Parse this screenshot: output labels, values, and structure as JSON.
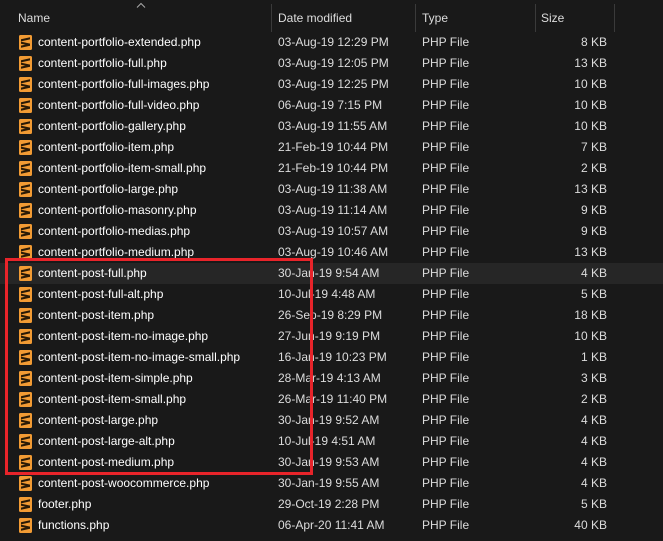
{
  "header": {
    "name": "Name",
    "date_modified": "Date modified",
    "type": "Type",
    "size": "Size"
  },
  "files": [
    {
      "name": "content-portfolio-extended.php",
      "date": "03-Aug-19 12:29 PM",
      "type": "PHP File",
      "size": "8 KB"
    },
    {
      "name": "content-portfolio-full.php",
      "date": "03-Aug-19 12:05 PM",
      "type": "PHP File",
      "size": "13 KB"
    },
    {
      "name": "content-portfolio-full-images.php",
      "date": "03-Aug-19 12:25 PM",
      "type": "PHP File",
      "size": "10 KB"
    },
    {
      "name": "content-portfolio-full-video.php",
      "date": "06-Aug-19 7:15 PM",
      "type": "PHP File",
      "size": "10 KB"
    },
    {
      "name": "content-portfolio-gallery.php",
      "date": "03-Aug-19 11:55 AM",
      "type": "PHP File",
      "size": "10 KB"
    },
    {
      "name": "content-portfolio-item.php",
      "date": "21-Feb-19 10:44 PM",
      "type": "PHP File",
      "size": "7 KB"
    },
    {
      "name": "content-portfolio-item-small.php",
      "date": "21-Feb-19 10:44 PM",
      "type": "PHP File",
      "size": "2 KB"
    },
    {
      "name": "content-portfolio-large.php",
      "date": "03-Aug-19 11:38 AM",
      "type": "PHP File",
      "size": "13 KB"
    },
    {
      "name": "content-portfolio-masonry.php",
      "date": "03-Aug-19 11:14 AM",
      "type": "PHP File",
      "size": "9 KB"
    },
    {
      "name": "content-portfolio-medias.php",
      "date": "03-Aug-19 10:57 AM",
      "type": "PHP File",
      "size": "9 KB"
    },
    {
      "name": "content-portfolio-medium.php",
      "date": "03-Aug-19 10:46 AM",
      "type": "PHP File",
      "size": "13 KB"
    },
    {
      "name": "content-post-full.php",
      "date": "30-Jan-19 9:54 AM",
      "type": "PHP File",
      "size": "4 KB",
      "selected": true
    },
    {
      "name": "content-post-full-alt.php",
      "date": "10-Jul-19 4:48 AM",
      "type": "PHP File",
      "size": "5 KB"
    },
    {
      "name": "content-post-item.php",
      "date": "26-Sep-19 8:29 PM",
      "type": "PHP File",
      "size": "18 KB"
    },
    {
      "name": "content-post-item-no-image.php",
      "date": "27-Jun-19 9:19 PM",
      "type": "PHP File",
      "size": "10 KB"
    },
    {
      "name": "content-post-item-no-image-small.php",
      "date": "16-Jan-19 10:23 PM",
      "type": "PHP File",
      "size": "1 KB"
    },
    {
      "name": "content-post-item-simple.php",
      "date": "28-Mar-19 4:13 AM",
      "type": "PHP File",
      "size": "3 KB"
    },
    {
      "name": "content-post-item-small.php",
      "date": "26-Mar-19 11:40 PM",
      "type": "PHP File",
      "size": "2 KB"
    },
    {
      "name": "content-post-large.php",
      "date": "30-Jan-19 9:52 AM",
      "type": "PHP File",
      "size": "4 KB"
    },
    {
      "name": "content-post-large-alt.php",
      "date": "10-Jul-19 4:51 AM",
      "type": "PHP File",
      "size": "4 KB"
    },
    {
      "name": "content-post-medium.php",
      "date": "30-Jan-19 9:53 AM",
      "type": "PHP File",
      "size": "4 KB"
    },
    {
      "name": "content-post-woocommerce.php",
      "date": "30-Jan-19 9:55 AM",
      "type": "PHP File",
      "size": "4 KB"
    },
    {
      "name": "footer.php",
      "date": "29-Oct-19 2:28 PM",
      "type": "PHP File",
      "size": "5 KB"
    },
    {
      "name": "functions.php",
      "date": "06-Apr-20 11:41 AM",
      "type": "PHP File",
      "size": "40 KB"
    }
  ],
  "icons": {
    "file": "sublime-php-file-icon",
    "sort": "sort-ascending-caret-icon"
  },
  "colors": {
    "background": "#191919",
    "icon_orange": "#f29b34",
    "highlight_red": "#e8242a",
    "selected_row": "#262626"
  }
}
